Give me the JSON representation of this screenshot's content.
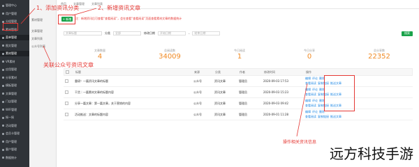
{
  "sidebar": {
    "items": [
      {
        "label": "管理中心",
        "icon": "dashboard-icon"
      },
      {
        "label": "用户管理",
        "icon": "user-icon"
      },
      {
        "label": "分组管理",
        "icon": "folder-icon"
      },
      {
        "label": "素材管理",
        "icon": "image-icon"
      },
      {
        "label": "菜单管理",
        "icon": "menu-icon"
      },
      {
        "label": "图文管理",
        "icon": "doc-icon"
      },
      {
        "label": "素材管理",
        "icon": "image-icon"
      },
      {
        "label": "VR素材",
        "icon": "vr-icon"
      },
      {
        "label": "应用管理",
        "icon": "app-icon"
      },
      {
        "label": "分享素材",
        "icon": "share-icon"
      },
      {
        "label": "模板管理",
        "icon": "template-icon"
      },
      {
        "label": "文章管理",
        "icon": "article-icon"
      },
      {
        "label": "门店管理",
        "icon": "store-icon"
      },
      {
        "label": "WiFi管理",
        "icon": "wifi-icon"
      },
      {
        "label": "摇一摇",
        "icon": "shake-icon"
      },
      {
        "label": "活动管理",
        "icon": "activity-icon"
      },
      {
        "label": "会员卡管理",
        "icon": "card-icon"
      },
      {
        "label": "用户管理",
        "icon": "user-icon"
      },
      {
        "label": "客户管理",
        "icon": "customer-icon"
      },
      {
        "label": "数据统计",
        "icon": "chart-icon"
      }
    ]
  },
  "subnav": {
    "title": "素材管理",
    "items": [
      "文章管理",
      "文章列表",
      "公众号列表"
    ]
  },
  "tabs": [
    "首页",
    "文章管理",
    "文章列表"
  ],
  "toolbar": {
    "add_label": "+ 新增",
    "notice": "注：新增资讯后可查看“查看阅读”，会在查看“查看阅读”页面查看素材文章的数据统计"
  },
  "filters": {
    "search_placeholder": "文章标题",
    "type_label": "分类",
    "type_value": "全部",
    "date_label": "修改日期",
    "date_start": "开始日期",
    "date_end": "结束日期",
    "search_button": "搜索"
  },
  "stats": [
    {
      "label": "文章数量",
      "value": "4"
    },
    {
      "label": "总阅读数",
      "value": "34009"
    },
    {
      "label": "今日阅读",
      "value": "1"
    },
    {
      "label": "今日分享",
      "value": "0"
    },
    {
      "label": "总分享数",
      "value": "22352"
    }
  ],
  "table": {
    "headers": [
      "",
      "标题",
      "来源",
      "分类",
      "作者",
      "修改时间",
      "操作"
    ],
    "rows": [
      {
        "title": "重磅！一篇资讯文章的标题",
        "source": "公众号",
        "category": "资讯文章",
        "author": "管理员",
        "date": "2020-09-03 17:53",
        "actions": [
          "编辑",
          "评论",
          "删除",
          "查看阅读",
          "复制链接",
          "推送文章"
        ]
      },
      {
        "title": "干货｜一篇素材文章的标题内容",
        "source": "公众号",
        "category": "资讯文章",
        "author": "管理员",
        "date": "2020-09-03 15:23",
        "actions": [
          "编辑",
          "评论",
          "删除",
          "查看阅读",
          "复制链接",
          "推送文章"
        ]
      },
      {
        "title": "分享一篇文章：第一篇文章，关于营销的内容",
        "source": "公众号",
        "category": "资讯文章",
        "author": "管理员",
        "date": "2020-09-03 09:42",
        "actions": [
          "编辑",
          "评论",
          "删除",
          "查看阅读",
          "复制链接",
          "推送文章"
        ]
      },
      {
        "title": "活动推送：文章的标题内容",
        "source": "公众号",
        "category": "资讯文章",
        "author": "管理员",
        "date": "2020-09-01 11:28",
        "actions": [
          "编辑",
          "评论",
          "删除",
          "查看阅读",
          "复制链接",
          "推送文章"
        ]
      }
    ]
  },
  "annotations": {
    "a1": "1、添加资讯分类",
    "a2": "2、新增资讯文章",
    "a3": "关联公众号资讯文章",
    "a4": "操作相关资讯信息"
  },
  "watermark": "远方科技手游"
}
